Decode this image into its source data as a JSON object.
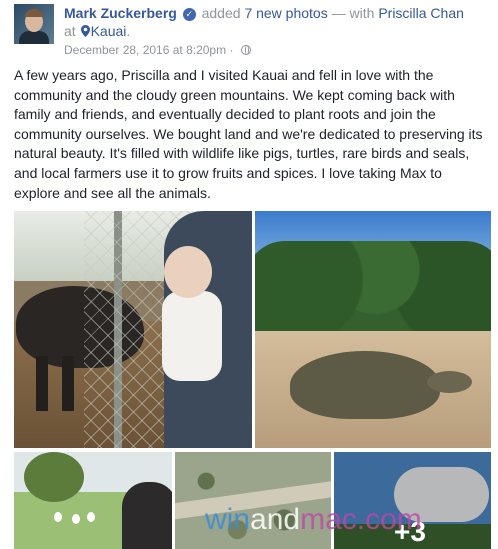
{
  "post": {
    "author": "Mark Zuckerberg",
    "action_text": "added",
    "photos_link": "7 new photos",
    "with_sep": "— with",
    "tagged": "Priscilla Chan",
    "at_text": "at",
    "location": "Kauai",
    "trailing_period": ".",
    "timestamp": "December 28, 2016 at 8:20pm",
    "dot": "·",
    "privacy_icon": "globe-icon",
    "verified_icon": "verified-badge-icon",
    "body": "A few years ago, Priscilla and I visited Kauai and fell in love with the community and the cloudy green mountains. We kept coming back with family and friends, and eventually decided to plant roots and join the community ourselves. We bought land and we're dedicated to preserving its natural beauty. It's filled with wildlife like pigs, turtles, rare birds and seals, and local farmers use it to grow fruits and spices. I love taking Max to explore and see all the animals.",
    "more_photos": "+3"
  },
  "watermark": {
    "part1": "win",
    "part2": "and",
    "part3": "mac.com"
  },
  "colors": {
    "link": "#365899",
    "meta": "#90949c",
    "text": "#1d2129"
  }
}
